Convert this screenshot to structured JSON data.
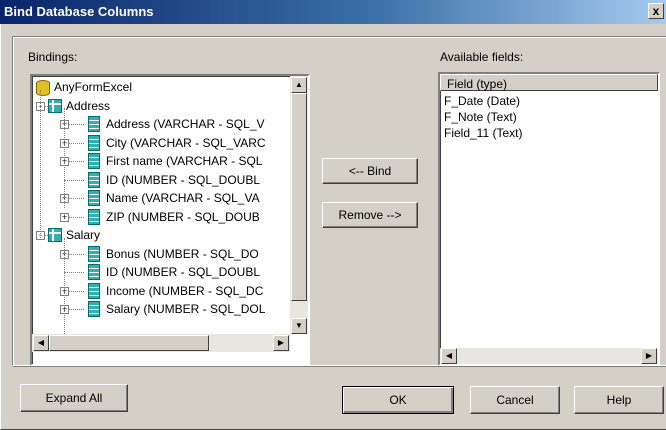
{
  "window": {
    "title": "Bind Database Columns",
    "close_glyph": "x"
  },
  "bindings": {
    "label": "Bindings:",
    "tree": [
      {
        "level": 0,
        "icon": "database-icon",
        "label": "AnyFormExcel"
      },
      {
        "level": 1,
        "icon": "table-icon",
        "label": "Address",
        "expander": "-"
      },
      {
        "level": 2,
        "icon": "column-icon",
        "label": "Address (VARCHAR - SQL_V",
        "expander": "+"
      },
      {
        "level": 2,
        "icon": "column-icon",
        "label": "City (VARCHAR - SQL_VARC",
        "expander": "+"
      },
      {
        "level": 2,
        "icon": "column-icon",
        "label": "First name (VARCHAR - SQL",
        "expander": "+"
      },
      {
        "level": 2,
        "icon": "column-icon",
        "label": "ID (NUMBER - SQL_DOUBL",
        "expander": ""
      },
      {
        "level": 2,
        "icon": "column-icon",
        "label": "Name (VARCHAR - SQL_VA",
        "expander": "+"
      },
      {
        "level": 2,
        "icon": "column-icon",
        "label": "ZIP (NUMBER - SQL_DOUB",
        "expander": "+"
      },
      {
        "level": 1,
        "icon": "table-icon",
        "label": "Salary",
        "expander": "-"
      },
      {
        "level": 2,
        "icon": "column-icon",
        "label": "Bonus (NUMBER - SQL_DO",
        "expander": "+"
      },
      {
        "level": 2,
        "icon": "column-icon",
        "label": "ID (NUMBER - SQL_DOUBL",
        "expander": ""
      },
      {
        "level": 2,
        "icon": "column-icon",
        "label": "Income (NUMBER - SQL_DC",
        "expander": "+"
      },
      {
        "level": 2,
        "icon": "column-icon",
        "label": "Salary (NUMBER - SQL_DOL",
        "expander": "+"
      }
    ]
  },
  "buttons": {
    "bind": "<-- Bind",
    "remove": "Remove -->",
    "expand_all": "Expand All",
    "ok": "OK",
    "cancel": "Cancel",
    "help": "Help"
  },
  "available": {
    "label": "Available fields:",
    "header": "Field (type)",
    "items": [
      "F_Date (Date)",
      "F_Note (Text)",
      "Field_11 (Text)"
    ]
  },
  "scroll_glyphs": {
    "up": "▲",
    "down": "▼",
    "left": "◀",
    "right": "▶"
  },
  "colors": {
    "titlebar_start": "#0a246a",
    "titlebar_end": "#a6caf0",
    "face": "#d4d0c8"
  }
}
